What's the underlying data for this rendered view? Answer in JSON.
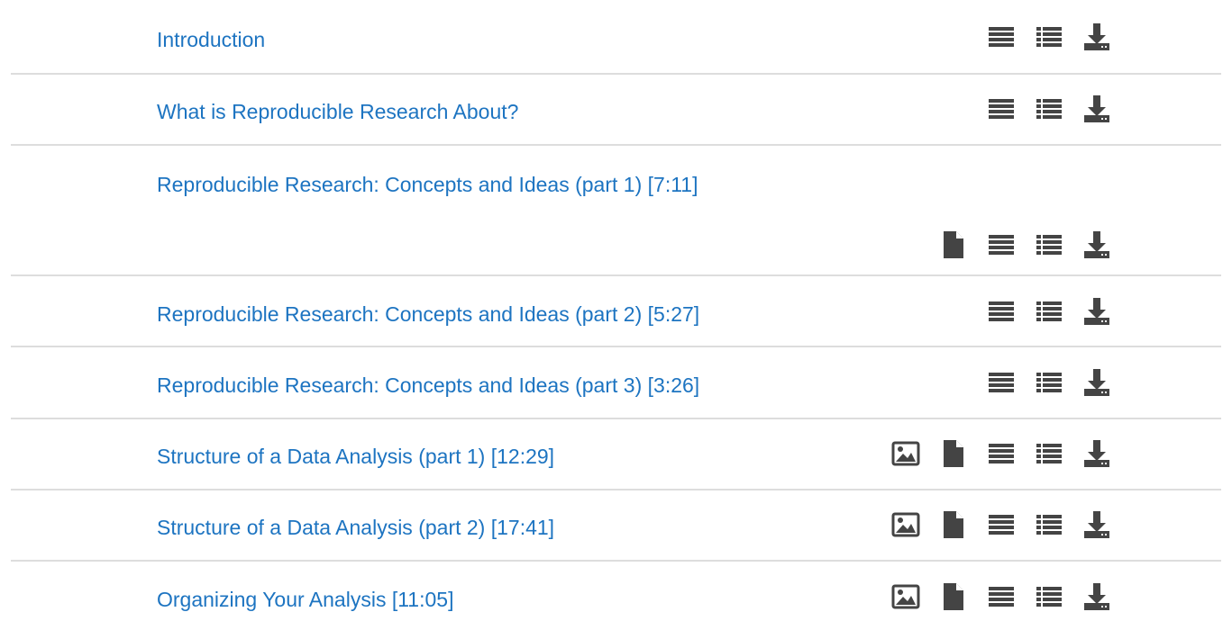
{
  "colors": {
    "link": "#1d74c1",
    "icon": "#444444",
    "divider": "#dddddd"
  },
  "icons": {
    "slides_image": "image-icon",
    "pdf": "file-icon",
    "transcript": "align-justify-icon",
    "subtitles": "list-icon",
    "download": "download-icon"
  },
  "lectures": [
    {
      "title": "Introduction",
      "resources": [
        "transcript",
        "subtitles",
        "download"
      ]
    },
    {
      "title": "What is Reproducible Research About?",
      "resources": [
        "transcript",
        "subtitles",
        "download"
      ]
    },
    {
      "title": "Reproducible Research: Concepts and Ideas (part 1) [7:11]",
      "resources": [
        "pdf",
        "transcript",
        "subtitles",
        "download"
      ]
    },
    {
      "title": "Reproducible Research: Concepts and Ideas (part 2) [5:27]",
      "resources": [
        "transcript",
        "subtitles",
        "download"
      ]
    },
    {
      "title": "Reproducible Research: Concepts and Ideas (part 3) [3:26]",
      "resources": [
        "transcript",
        "subtitles",
        "download"
      ]
    },
    {
      "title": "Structure of a Data Analysis (part 1) [12:29]",
      "resources": [
        "slides_image",
        "pdf",
        "transcript",
        "subtitles",
        "download"
      ]
    },
    {
      "title": "Structure of a Data Analysis (part 2) [17:41]",
      "resources": [
        "slides_image",
        "pdf",
        "transcript",
        "subtitles",
        "download"
      ]
    },
    {
      "title": "Organizing Your Analysis [11:05]",
      "resources": [
        "slides_image",
        "pdf",
        "transcript",
        "subtitles",
        "download"
      ]
    }
  ]
}
